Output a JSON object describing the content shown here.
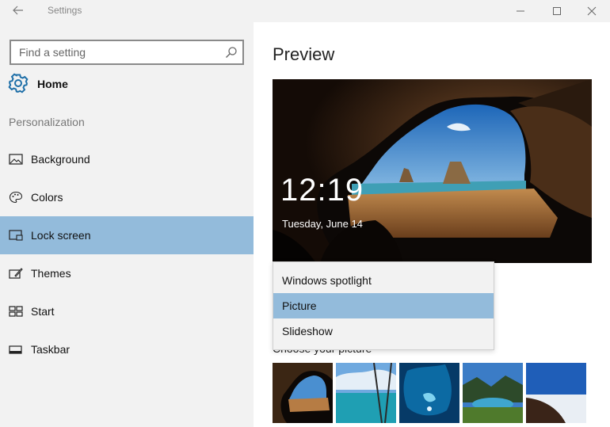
{
  "window": {
    "title": "Settings",
    "back_icon": "back-arrow-icon",
    "controls": [
      "minimize-icon",
      "maximize-icon",
      "close-icon"
    ]
  },
  "sidebar": {
    "search": {
      "placeholder": "Find a setting",
      "value": ""
    },
    "home_label": "Home",
    "section_label": "Personalization",
    "items": [
      {
        "label": "Background",
        "icon": "picture-icon",
        "active": false
      },
      {
        "label": "Colors",
        "icon": "palette-icon",
        "active": false
      },
      {
        "label": "Lock screen",
        "icon": "lock-screen-icon",
        "active": true
      },
      {
        "label": "Themes",
        "icon": "themes-icon",
        "active": false
      },
      {
        "label": "Start",
        "icon": "start-icon",
        "active": false
      },
      {
        "label": "Taskbar",
        "icon": "taskbar-icon",
        "active": false
      }
    ]
  },
  "main": {
    "title": "Preview",
    "preview": {
      "time": "12:19",
      "date": "Tuesday, June 14"
    },
    "background_dropdown": {
      "options": [
        "Windows spotlight",
        "Picture",
        "Slideshow"
      ],
      "selected": "Picture"
    },
    "choose_picture_label": "Choose your picture"
  },
  "colors": {
    "accent": "#93bbdb",
    "sidebar_bg": "#f2f2f2"
  }
}
